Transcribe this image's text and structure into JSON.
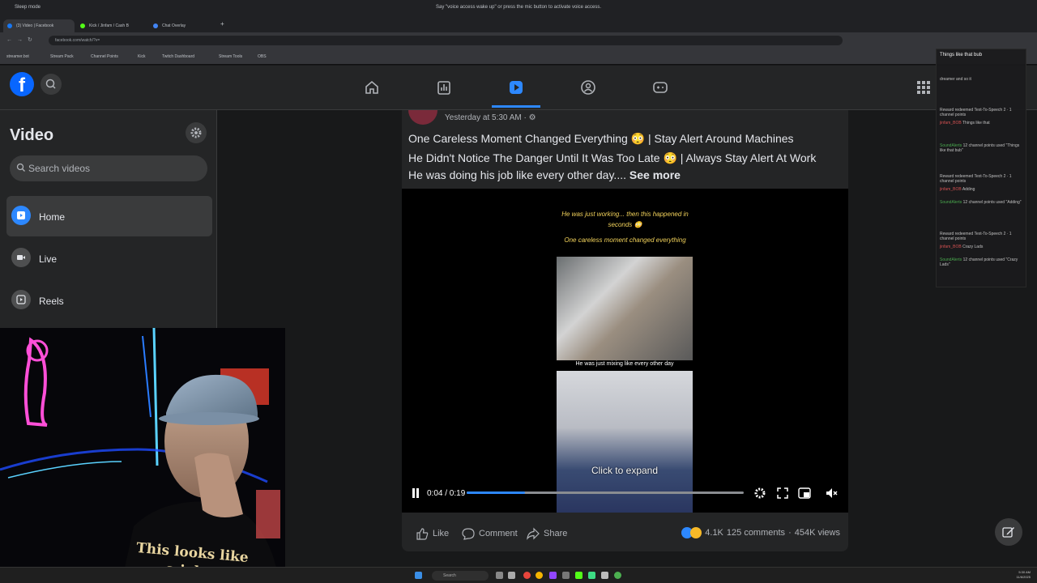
{
  "browser": {
    "window_label": "Sleep mode",
    "voice_notice": "Say \"voice access wake up\" or press the mic button to activate voice access.",
    "tabs": [
      {
        "label": "(3) Video | Facebook",
        "active": true,
        "color": "#1877f2"
      },
      {
        "label": "Kick / Jinfam / Cash B",
        "active": false,
        "color": "#53fc18"
      },
      {
        "label": "Chat Overlay",
        "active": false,
        "color": "#4285f4"
      }
    ],
    "url": "facebook.com/watch/?v=",
    "bookmarks": [
      "streamer.bot",
      "Stream Pack",
      "Channel Points",
      "Kick",
      "Twitch Dashboard",
      "Stream Tools",
      "OBS"
    ]
  },
  "fb": {
    "brand_color": "#0866ff",
    "nav": [
      {
        "name": "home",
        "active": false
      },
      {
        "name": "leaderboard",
        "active": false
      },
      {
        "name": "video",
        "active": true
      },
      {
        "name": "groups",
        "active": false
      },
      {
        "name": "gaming",
        "active": false
      }
    ]
  },
  "sidebar": {
    "title": "Video",
    "search_placeholder": "Search videos",
    "items": [
      {
        "label": "Home",
        "active": true
      },
      {
        "label": "Live",
        "active": false
      },
      {
        "label": "Reels",
        "active": false
      }
    ]
  },
  "post": {
    "timestamp": "Yesterday at 5:30 AM · ⚙",
    "title": "One Careless Moment Changed Everything 😳 | Stay Alert Around Machines",
    "line2": "He Didn't Notice The Danger Until It Was Too Late 😳 | Always Stay Alert At Work",
    "line3": "He was doing his job like every other day....",
    "see_more": "See more",
    "video": {
      "caption_line1": "He was just working... then this happened in",
      "caption_line2": "seconds 😳",
      "caption_line3": "One careless moment changed everything",
      "mid_caption": "He was just mixing like every other day",
      "expand_text": "Click to expand",
      "time": "0:04 / 0:19",
      "progress": 0.21
    },
    "actions": {
      "like": "Like",
      "comment": "Comment",
      "share": "Share"
    },
    "reaction_count": "4.1K",
    "comments": "125 comments",
    "views": "454K views"
  },
  "webcam": {
    "shirt_text_1": "This looks like",
    "shirt_text_2": "a job"
  },
  "chat": [
    {
      "user": "",
      "text": "Things like that bub"
    },
    {
      "user": "",
      "text": "dreamer and so it"
    },
    {
      "user": "Reward redeemed",
      "text": "Text-To-Speech 2 · 1 channel points"
    },
    {
      "user": "jinfam_BOB",
      "text": "Things like that"
    },
    {
      "user": "SoundAlerts",
      "text": "12 channel points used \"Things like that bub\""
    },
    {
      "user": "Reward redeemed",
      "text": "Text-To-Speech 2 · 1 channel points"
    },
    {
      "user": "jinfam_BOB",
      "text": "Adding"
    },
    {
      "user": "SoundAlerts",
      "text": "12 channel points used \"Adding\""
    },
    {
      "user": "Reward redeemed",
      "text": "Text-To-Speech 2 · 1 channel points"
    },
    {
      "user": "jinfam_BOB",
      "text": "Crazy Lads"
    },
    {
      "user": "SoundAlerts",
      "text": "12 channel points used \"Crazy Lads\""
    }
  ],
  "taskbar": {
    "search": "Search",
    "time": "5:30 AM",
    "date": "11/6/2025"
  }
}
